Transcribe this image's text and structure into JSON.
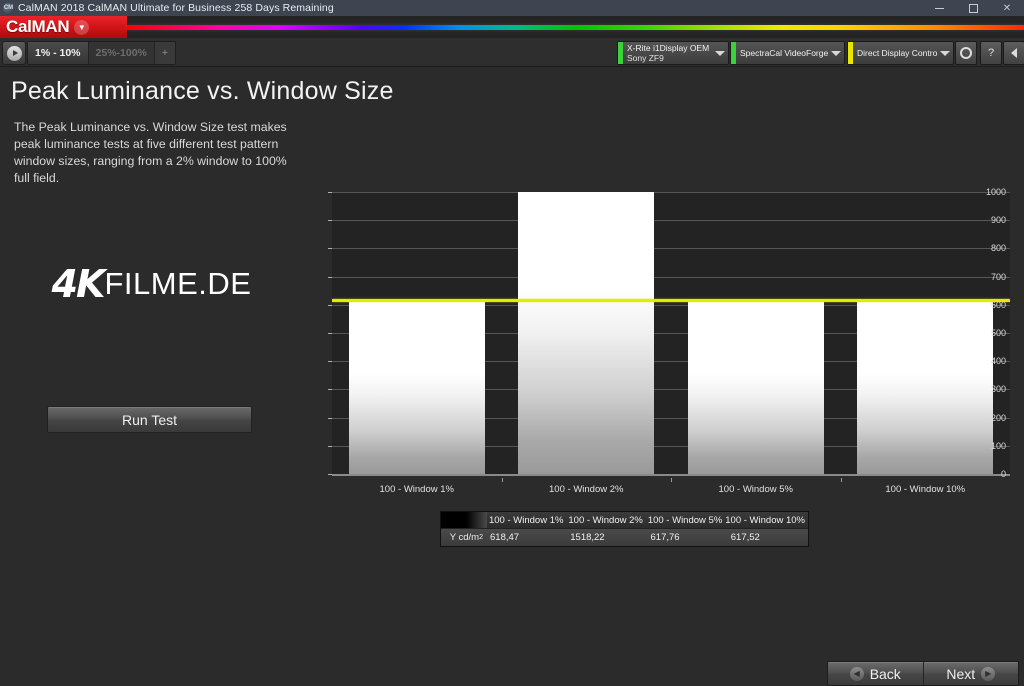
{
  "window": {
    "title": "CalMAN 2018 CalMAN Ultimate for Business 258 Days Remaining",
    "app_icon": "calman-icon",
    "minimize": "minimize-icon",
    "maximize": "maximize-icon",
    "close": "close-icon"
  },
  "brand": {
    "name": "CalMAN",
    "caret": "▼"
  },
  "toolbar": {
    "play_icon": "play-icon",
    "tabs": [
      {
        "label": "1% - 10%",
        "active": true
      },
      {
        "label": "25%-100%",
        "active": false
      },
      {
        "label": "+",
        "active": false
      }
    ],
    "dropdowns": [
      {
        "line1": "X-Rite i1Display OEM",
        "line2": "Sony ZF9",
        "led": "#3bd13b",
        "caret": "▼"
      },
      {
        "line1": "SpectraCal VideoForge Pro",
        "line2": "",
        "led": "#3bd13b",
        "caret": "▼"
      },
      {
        "line1": "Direct Display Control",
        "line2": "",
        "led": "#e6e600",
        "caret": "▼"
      }
    ],
    "icons": [
      {
        "name": "gear-icon",
        "glyph": ""
      },
      {
        "name": "help-icon",
        "glyph": "?"
      },
      {
        "name": "collapse-icon",
        "glyph": ""
      }
    ]
  },
  "page": {
    "title": "Peak Luminance vs. Window Size",
    "description": "The Peak Luminance vs. Window Size test makes peak luminance tests at five different test pattern window sizes, ranging from a 2% window to 100% full field.",
    "watermark_4k": "4K",
    "watermark_rest": "FILME.DE",
    "run_test": "Run Test"
  },
  "footer": {
    "back": "Back",
    "next": "Next",
    "back_icon": "chevron-left-icon",
    "next_icon": "chevron-right-icon"
  },
  "table": {
    "row_label": "Y cd/m",
    "row_label_sup": "2",
    "headers": [
      "100 - Window  1%",
      "100 - Window  2%",
      "100 - Window  5%",
      "100 - Window 10%"
    ],
    "values": [
      "618,47",
      "1518,22",
      "617,76",
      "617,52"
    ]
  },
  "chart_data": {
    "type": "bar",
    "title": "Peak Luminance vs. Window Size",
    "categories": [
      "100 - Window  1%",
      "100 - Window  2%",
      "100 - Window  5%",
      "100 - Window 10%"
    ],
    "values": [
      618.47,
      1518.22,
      617.76,
      617.52
    ],
    "series": [
      {
        "name": "Y cd/m2",
        "values": [
          618.47,
          1518.22,
          617.76,
          617.52
        ]
      }
    ],
    "xlabel": "",
    "ylabel": "",
    "ylim": [
      0,
      1000
    ],
    "yticks": [
      0,
      100,
      200,
      300,
      400,
      500,
      600,
      700,
      800,
      900,
      1000
    ],
    "grid": true,
    "legend": false,
    "reference_line": {
      "value": 618,
      "color": "#e8e800"
    },
    "bar_color": "#ffffff",
    "plot_background": "#232323",
    "note": "The 2% bar value 1518.22 exceeds the 1000 axis maximum and is clipped at the top of the plot area."
  }
}
